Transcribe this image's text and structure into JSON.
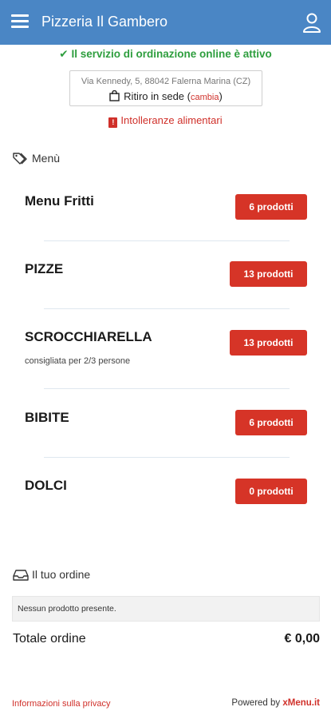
{
  "header": {
    "title": "Pizzeria Il Gambero",
    "menu_icon": "hamburger-menu-icon",
    "user_icon": "user-icon"
  },
  "status": {
    "text": "Il servizio di ordinazione online è attivo",
    "color": "#2e9e3e"
  },
  "store": {
    "address": "Via Kennedy, 5, 88042 Falerna Marina (CZ)",
    "pickup_label": "Ritiro in sede",
    "change_open": "(",
    "change_label": "cambia",
    "change_close": ")"
  },
  "intolerances": {
    "badge": "!",
    "label": "Intolleranze alimentari"
  },
  "menu": {
    "heading": "Menù",
    "categories": [
      {
        "name": "Menu Fritti",
        "subtitle": "",
        "count": "6 prodotti"
      },
      {
        "name": "PIZZE",
        "subtitle": "",
        "count": "13 prodotti"
      },
      {
        "name": "SCROCCHIARELLA",
        "subtitle": "consigliata per 2/3 persone",
        "count": "13 prodotti"
      },
      {
        "name": "BIBITE",
        "subtitle": "",
        "count": "6 prodotti"
      },
      {
        "name": "DOLCI",
        "subtitle": "",
        "count": "0 prodotti"
      }
    ]
  },
  "order": {
    "heading": "Il tuo ordine",
    "empty_text": "Nessun prodotto presente.",
    "total_label": "Totale ordine",
    "total_value": "€ 0,00"
  },
  "footer": {
    "privacy": "Informazioni sulla privacy",
    "powered_prefix": "Powered by ",
    "powered_brand": "xMenu.it"
  },
  "colors": {
    "header_bg": "#4a86c5",
    "accent_red": "#d63427",
    "status_green": "#2e9e3e"
  }
}
